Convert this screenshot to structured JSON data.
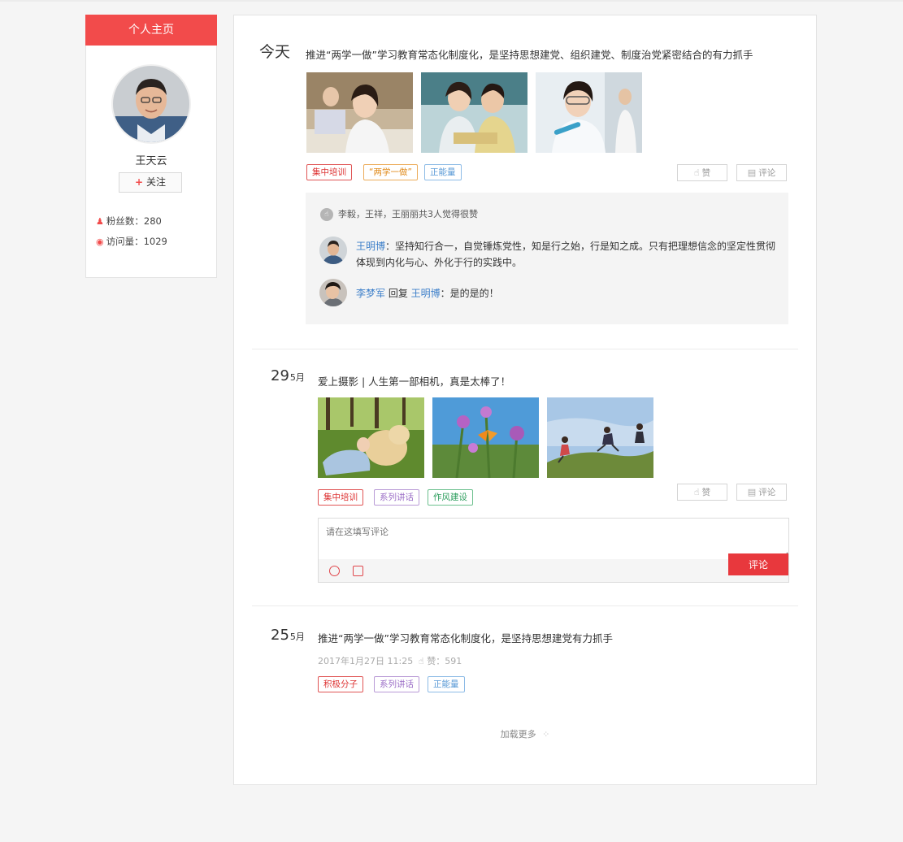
{
  "profile": {
    "header": "个人主页",
    "name": "王天云",
    "follow_label": "关注",
    "fans_label": "粉丝数：280",
    "visits_label": "访问量：1029"
  },
  "posts": [
    {
      "date_main": "今天",
      "date_sub": "",
      "title": "推进“两学一做”学习教育常态化制度化，是坚持思想建党、组织建党、制度治党紧密结合的有力抓手",
      "tags": [
        "集中培训",
        "“两学一做”",
        "正能量"
      ],
      "like_label": "赞",
      "comment_label": "评论",
      "likes_text": "李毅，王祥，王丽丽共3人觉得很赞",
      "comments": [
        {
          "author": "王明博",
          "text": "：坚持知行合一，自觉锤炼党性，知是行之始，行是知之成。只有把理想信念的坚定性贯彻",
          "text2": "体现到内化与心、外化于行的实践中。"
        },
        {
          "author": "李梦军",
          "reply_word": " 回复 ",
          "reply_to": "王明博",
          "text": "：是的是的！"
        }
      ]
    },
    {
      "date_main": "29",
      "date_sub": "5月",
      "title": "爱上摄影 | 人生第一部相机，真是太棒了！",
      "tags": [
        "集中培训",
        "系列讲话",
        "作风建设"
      ],
      "like_label": "赞",
      "comment_label": "评论",
      "reply_placeholder": "请在这填写评论",
      "reply_submit": "评论"
    },
    {
      "date_main": "25",
      "date_sub": "5月",
      "title": "推进“两学一做”学习教育常态化制度化，是坚持思想建党有力抓手",
      "timestamp": "2017年1月27日 11:25",
      "likes": "赞：591",
      "tags": [
        "积极分子",
        "系列讲话",
        "正能量"
      ]
    }
  ],
  "load_more": "加载更多",
  "colors": {
    "accent": "#f24b4b",
    "link": "#3d7fc9"
  }
}
